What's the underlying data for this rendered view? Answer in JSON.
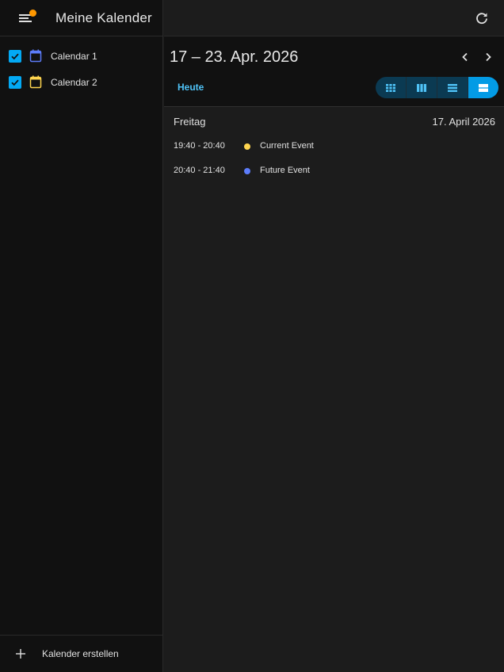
{
  "sidebar": {
    "title": "Meine Kalender",
    "calendars": [
      {
        "label": "Calendar 1",
        "color": "#5c7cfa",
        "checked": true
      },
      {
        "label": "Calendar 2",
        "color": "#ffd54f",
        "checked": true
      }
    ],
    "create_label": "Kalender erstellen"
  },
  "toolbar": {
    "range_title": "17 – 23. Apr. 2026",
    "today_label": "Heute",
    "views": [
      "month-view-icon",
      "week-view-icon",
      "day-view-icon",
      "list-view-icon"
    ],
    "active_view": "list-view-icon"
  },
  "agenda": {
    "day_name": "Freitag",
    "day_date": "17. April 2026",
    "events": [
      {
        "time": "19:40 - 20:40",
        "title": "Current Event",
        "color": "#ffd54f"
      },
      {
        "time": "20:40 - 21:40",
        "title": "Future Event",
        "color": "#5c7cfa"
      }
    ]
  },
  "colors": {
    "accent": "#03a9f4",
    "notification": "#ff9800"
  }
}
